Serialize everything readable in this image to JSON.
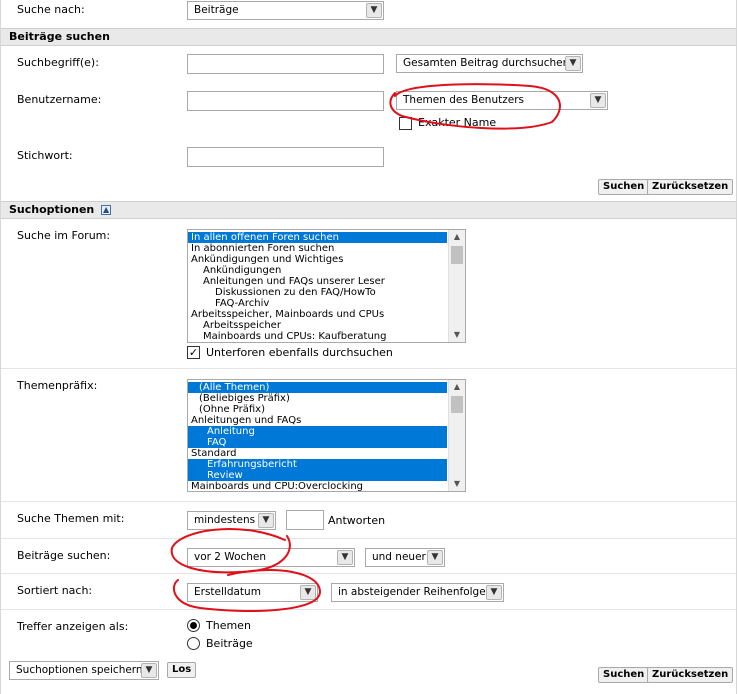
{
  "search_for": {
    "label": "Suche nach:",
    "value": "Beiträge"
  },
  "section_posts": {
    "title": "Beiträge suchen",
    "term_label": "Suchbegriff(e):",
    "term_value": "",
    "term_scope": "Gesamten Beitrag durchsuchen",
    "username_label": "Benutzername:",
    "username_value": "",
    "username_scope": "Themen des Benutzers",
    "exact_name_label": "Exakter Name",
    "keyword_label": "Stichwort:",
    "keyword_value": "",
    "search_button": "Suchen",
    "reset_button": "Zurücksetzen"
  },
  "section_options": {
    "title": "Suchoptionen",
    "forum_label": "Suche im Forum:",
    "forum_items": [
      {
        "text": "In allen offenen Foren suchen",
        "indent": 0,
        "selected": true
      },
      {
        "text": "In abonnierten Foren suchen",
        "indent": 0,
        "selected": false
      },
      {
        "text": "Ankündigungen und Wichtiges",
        "indent": 0,
        "selected": false
      },
      {
        "text": "Ankündigungen",
        "indent": 1,
        "selected": false
      },
      {
        "text": "Anleitungen und FAQs unserer Leser",
        "indent": 1,
        "selected": false
      },
      {
        "text": "Diskussionen zu den FAQ/HowTo",
        "indent": 2,
        "selected": false
      },
      {
        "text": "FAQ-Archiv",
        "indent": 2,
        "selected": false
      },
      {
        "text": "Arbeitsspeicher, Mainboards und CPUs",
        "indent": 0,
        "selected": false
      },
      {
        "text": "Arbeitsspeicher",
        "indent": 1,
        "selected": false
      },
      {
        "text": "Mainboards und CPUs: Kaufberatung",
        "indent": 1,
        "selected": false
      }
    ],
    "subforums_label": "Unterforen ebenfalls durchsuchen",
    "prefix_label": "Themenpräfix:",
    "prefix_items": [
      {
        "text": "(Alle Themen)",
        "indent": 1,
        "selected": true
      },
      {
        "text": "(Beliebiges Präfix)",
        "indent": 1,
        "selected": false
      },
      {
        "text": "(Ohne Präfix)",
        "indent": 1,
        "selected": false
      },
      {
        "text": "Anleitungen und FAQs",
        "indent": 0,
        "selected": false
      },
      {
        "text": "Anleitung",
        "indent": 2,
        "selected": true
      },
      {
        "text": "FAQ",
        "indent": 2,
        "selected": true
      },
      {
        "text": "Standard",
        "indent": 0,
        "selected": false
      },
      {
        "text": "Erfahrungsbericht",
        "indent": 2,
        "selected": true
      },
      {
        "text": "Review",
        "indent": 2,
        "selected": true
      },
      {
        "text": "Mainboards und CPU:Overclocking",
        "indent": 0,
        "selected": false
      }
    ],
    "threads_with_label": "Suche Themen mit:",
    "threads_with_mode": "mindestens",
    "threads_with_count": "",
    "threads_with_unit": "Antworten",
    "posts_from_label": "Beiträge suchen:",
    "posts_from_value": "vor 2 Wochen",
    "posts_from_dir": "und neuer",
    "sort_label": "Sortiert nach:",
    "sort_value": "Erstelldatum",
    "sort_order": "in absteigender Reihenfolge",
    "show_as_label": "Treffer anzeigen als:",
    "show_as_threads": "Themen",
    "show_as_posts": "Beiträge"
  },
  "footer": {
    "save_options": "Suchoptionen speichern",
    "go_button": "Los",
    "search_button": "Suchen",
    "reset_button": "Zurücksetzen"
  },
  "annotation_color": "#e0101a"
}
